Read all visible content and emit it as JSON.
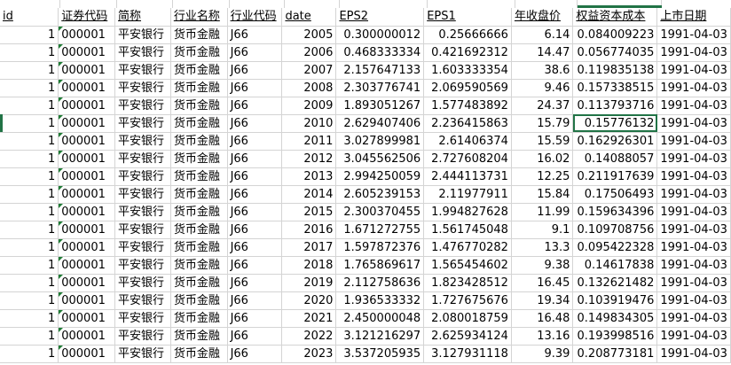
{
  "sheet": {
    "headers": [
      "id",
      "证券代码",
      "简称",
      "行业名称",
      "行业代码",
      "date",
      "EPS2",
      "EPS1",
      "年收盘价",
      "权益资本成本",
      "上市日期"
    ],
    "selected": {
      "row": 5,
      "col": 9
    },
    "rows": [
      [
        "1",
        "000001",
        "平安银行",
        "货币金融",
        "J66",
        "2005",
        "0.300000012",
        "0.25666666",
        "6.14",
        "0.084009223",
        "1991-04-03"
      ],
      [
        "1",
        "000001",
        "平安银行",
        "货币金融",
        "J66",
        "2006",
        "0.468333334",
        "0.421692312",
        "14.47",
        "0.056774035",
        "1991-04-03"
      ],
      [
        "1",
        "000001",
        "平安银行",
        "货币金融",
        "J66",
        "2007",
        "2.157647133",
        "1.603333354",
        "38.6",
        "0.119835138",
        "1991-04-03"
      ],
      [
        "1",
        "000001",
        "平安银行",
        "货币金融",
        "J66",
        "2008",
        "2.303776741",
        "2.069590569",
        "9.46",
        "0.157338515",
        "1991-04-03"
      ],
      [
        "1",
        "000001",
        "平安银行",
        "货币金融",
        "J66",
        "2009",
        "1.893051267",
        "1.577483892",
        "24.37",
        "0.113793716",
        "1991-04-03"
      ],
      [
        "1",
        "000001",
        "平安银行",
        "货币金融",
        "J66",
        "2010",
        "2.629407406",
        "2.236415863",
        "15.79",
        "0.15776132",
        "1991-04-03"
      ],
      [
        "1",
        "000001",
        "平安银行",
        "货币金融",
        "J66",
        "2011",
        "3.027899981",
        "2.61406374",
        "15.59",
        "0.162926301",
        "1991-04-03"
      ],
      [
        "1",
        "000001",
        "平安银行",
        "货币金融",
        "J66",
        "2012",
        "3.045562506",
        "2.727608204",
        "16.02",
        "0.14088057",
        "1991-04-03"
      ],
      [
        "1",
        "000001",
        "平安银行",
        "货币金融",
        "J66",
        "2013",
        "2.994250059",
        "2.444113731",
        "12.25",
        "0.211917639",
        "1991-04-03"
      ],
      [
        "1",
        "000001",
        "平安银行",
        "货币金融",
        "J66",
        "2014",
        "2.605239153",
        "2.11977911",
        "15.84",
        "0.17506493",
        "1991-04-03"
      ],
      [
        "1",
        "000001",
        "平安银行",
        "货币金融",
        "J66",
        "2015",
        "2.300370455",
        "1.994827628",
        "11.99",
        "0.159634396",
        "1991-04-03"
      ],
      [
        "1",
        "000001",
        "平安银行",
        "货币金融",
        "J66",
        "2016",
        "1.671272755",
        "1.561745048",
        "9.1",
        "0.109708756",
        "1991-04-03"
      ],
      [
        "1",
        "000001",
        "平安银行",
        "货币金融",
        "J66",
        "2017",
        "1.597872376",
        "1.476770282",
        "13.3",
        "0.095422328",
        "1991-04-03"
      ],
      [
        "1",
        "000001",
        "平安银行",
        "货币金融",
        "J66",
        "2018",
        "1.765869617",
        "1.565454602",
        "9.38",
        "0.14617838",
        "1991-04-03"
      ],
      [
        "1",
        "000001",
        "平安银行",
        "货币金融",
        "J66",
        "2019",
        "2.112758636",
        "1.823428512",
        "16.45",
        "0.132621482",
        "1991-04-03"
      ],
      [
        "1",
        "000001",
        "平安银行",
        "货币金融",
        "J66",
        "2020",
        "1.936533332",
        "1.727675676",
        "19.34",
        "0.103919476",
        "1991-04-03"
      ],
      [
        "1",
        "000001",
        "平安银行",
        "货币金融",
        "J66",
        "2021",
        "2.450000048",
        "2.080018759",
        "16.48",
        "0.149834305",
        "1991-04-03"
      ],
      [
        "1",
        "000001",
        "平安银行",
        "货币金融",
        "J66",
        "2022",
        "3.121216297",
        "2.625934124",
        "13.16",
        "0.193998516",
        "1991-04-03"
      ],
      [
        "1",
        "000001",
        "平安银行",
        "货币金融",
        "J66",
        "2023",
        "3.537205935",
        "3.127931118",
        "9.39",
        "0.208773181",
        "1991-04-03"
      ]
    ]
  }
}
